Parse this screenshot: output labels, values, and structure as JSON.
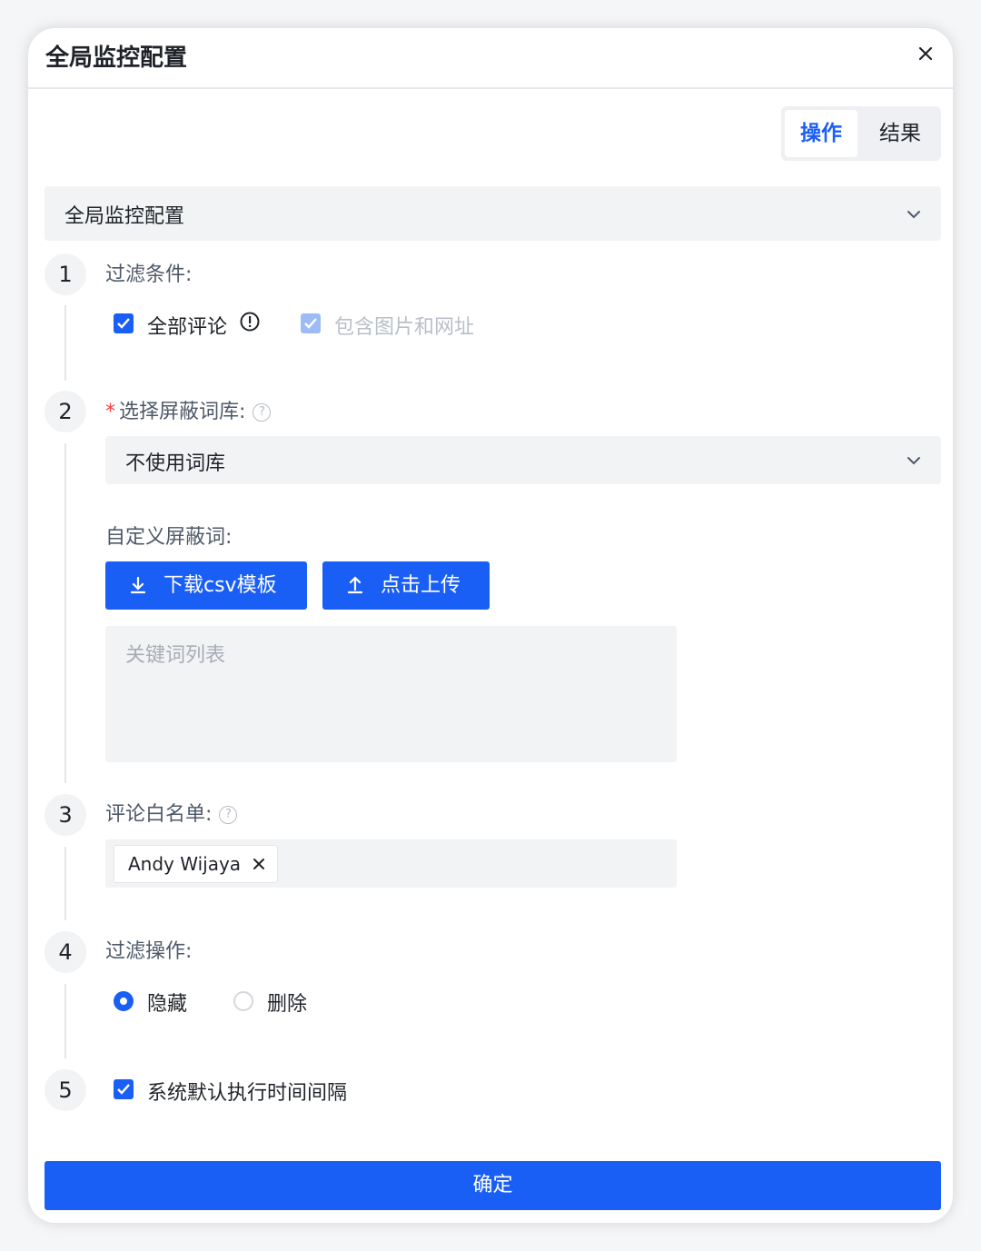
{
  "dialog": {
    "title": "全局监控配置"
  },
  "segmented": {
    "active": "操作",
    "other": "结果"
  },
  "config_select": {
    "value": "全局监控配置"
  },
  "steps": {
    "s1": {
      "num": "1",
      "label": "过滤条件:",
      "all_comments": "全部评论",
      "include_media": "包含图片和网址"
    },
    "s2": {
      "num": "2",
      "required_mark": "*",
      "label": "选择屏蔽词库:",
      "library_value": "不使用词库",
      "custom_label": "自定义屏蔽词:",
      "download_btn": "下载csv模板",
      "upload_btn": "点击上传",
      "keywords_placeholder": "关键词列表"
    },
    "s3": {
      "num": "3",
      "label": "评论白名单:",
      "tags": [
        "Andy Wijaya"
      ]
    },
    "s4": {
      "num": "4",
      "label": "过滤操作:",
      "opt_hide": "隐藏",
      "opt_delete": "删除",
      "selected": "隐藏"
    },
    "s5": {
      "num": "5",
      "label": "系统默认执行时间间隔"
    }
  },
  "footer": {
    "confirm": "确定"
  },
  "colors": {
    "primary": "#1a5ff5",
    "required": "#f53f3f",
    "field_bg": "#f2f3f5"
  },
  "icons": [
    "close-icon",
    "chevron-down-icon",
    "info-icon",
    "help-icon",
    "download-icon",
    "upload-icon",
    "check-icon",
    "tag-close-icon"
  ]
}
